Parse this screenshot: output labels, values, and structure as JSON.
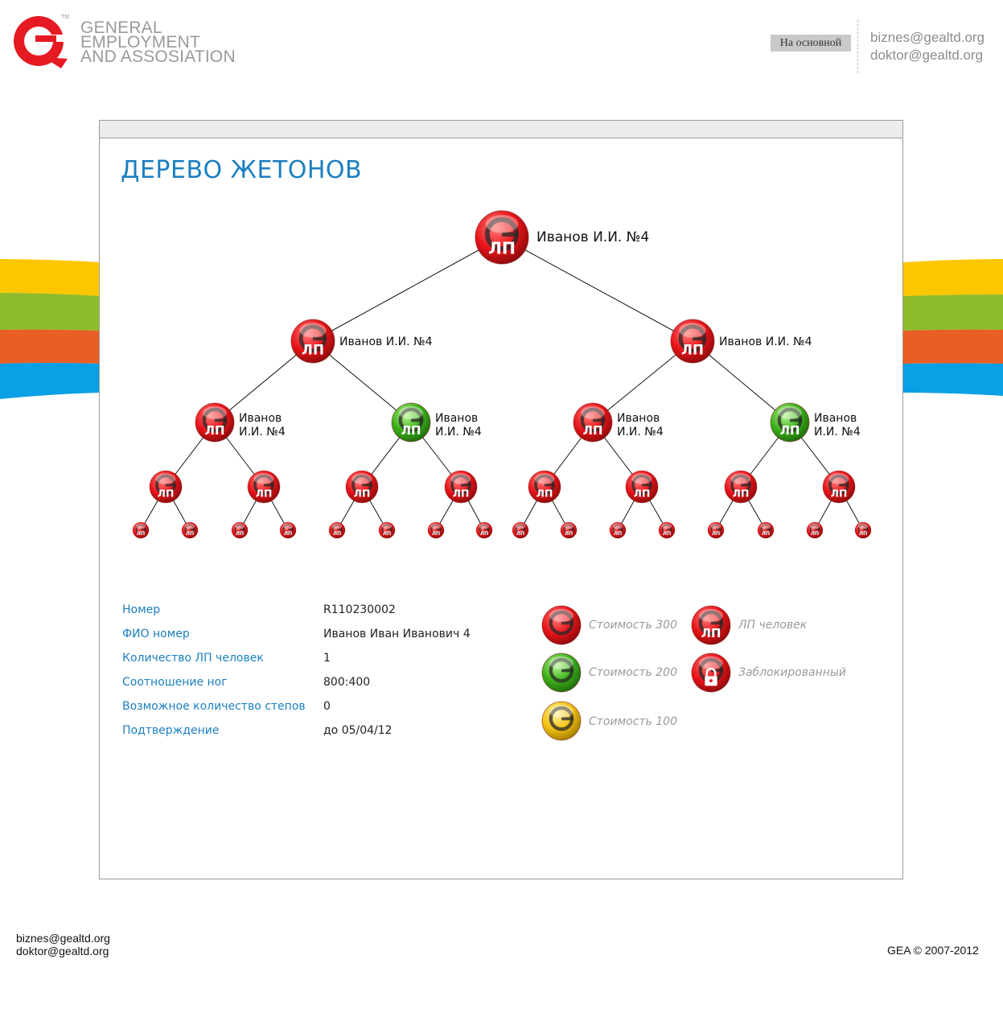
{
  "header": {
    "logo_lines": [
      "GENERAL",
      "EMPLOYMENT",
      "AND ASSOSIATION"
    ],
    "logo_tm": "TM",
    "home_button": "На основной",
    "emails": [
      "biznes@gealtd.org",
      "doktor@gealtd.org"
    ]
  },
  "colors": {
    "stripe_yellow": "#fdc700",
    "stripe_green": "#8ebb2a",
    "stripe_orange": "#e95e25",
    "stripe_blue": "#0aa0e6",
    "title_blue": "#1b7fc0",
    "token_red": "#e8141a",
    "token_green": "#3cb01a",
    "token_yellow": "#f2c212"
  },
  "main": {
    "title": "ДЕРЕВО ЖЕТОНОВ",
    "tree": {
      "token_text": "ЛП",
      "node_label": "Иванов И.И. №4",
      "node_label_wrapped": [
        "Иванов",
        "И.И. №4"
      ],
      "level2_colors": [
        "red",
        "green",
        "red",
        "green"
      ]
    },
    "info": [
      {
        "label": "Номер",
        "value": "R110230002"
      },
      {
        "label": "ФИО номер",
        "value": "Иванов Иван Иванович 4"
      },
      {
        "label": "Количество ЛП человек",
        "value": "1"
      },
      {
        "label": "Соотношение ног",
        "value": "800:400"
      },
      {
        "label": "Возможное количество степов",
        "value": "0"
      },
      {
        "label": "Подтверждение",
        "value": "до 05/04/12"
      }
    ],
    "legend": [
      {
        "icon": "token-red-icon",
        "text": "Стоимость 300"
      },
      {
        "icon": "token-lp-icon",
        "text": "ЛП человек"
      },
      {
        "icon": "token-green-icon",
        "text": "Стоимость 200"
      },
      {
        "icon": "token-locked-icon",
        "text": "Заблокированный"
      },
      {
        "icon": "token-yellow-icon",
        "text": "Стоимость 100"
      }
    ]
  },
  "footer": {
    "emails": [
      "biznes@gealtd.org",
      "doktor@gealtd.org"
    ],
    "copyright": "GEA © 2007-2012"
  }
}
